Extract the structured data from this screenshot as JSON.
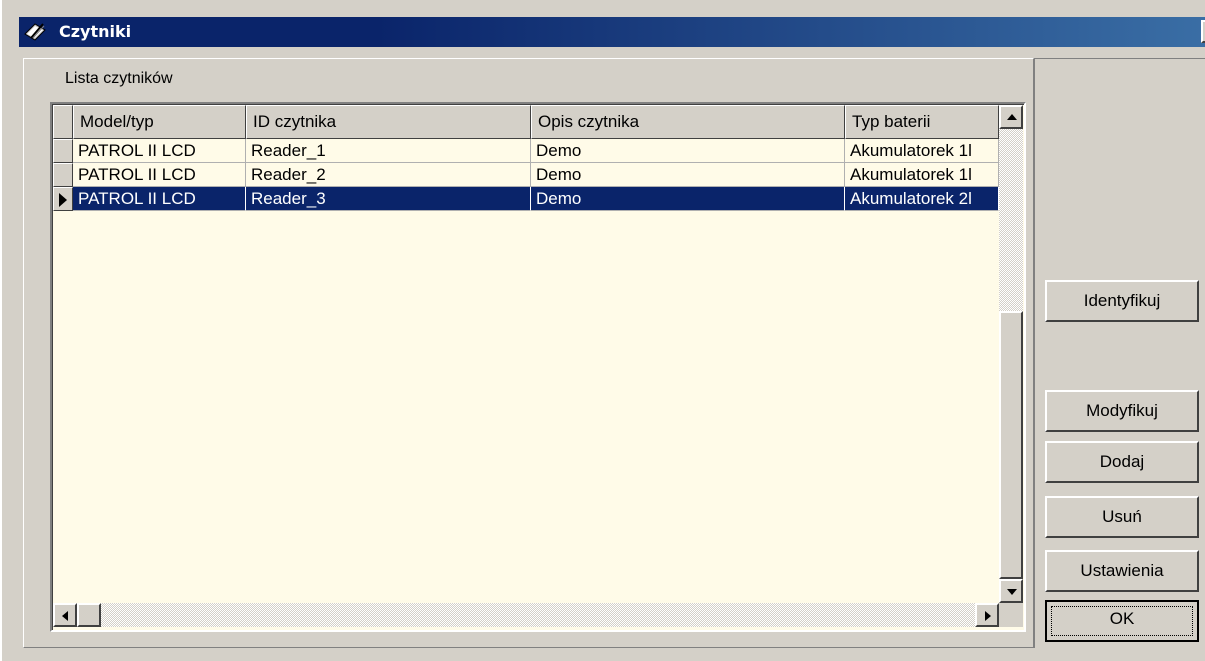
{
  "window": {
    "title": "Czytniki",
    "close_glyph": "✕"
  },
  "list": {
    "label": "Lista czytników",
    "columns": [
      "Model/typ",
      "ID czytnika",
      "Opis czytnika",
      "Typ  baterii"
    ],
    "rows": [
      {
        "model": "PATROL II LCD",
        "id": "Reader_1",
        "desc": "Demo",
        "battery": "Akumulatorek 1l"
      },
      {
        "model": "PATROL II LCD",
        "id": "Reader_2",
        "desc": "Demo",
        "battery": "Akumulatorek 1l"
      },
      {
        "model": "PATROL II LCD",
        "id": "Reader_3",
        "desc": "Demo",
        "battery": "Akumulatorek 2l"
      }
    ],
    "selected_row": 3
  },
  "buttons": {
    "identify": "Identyfikuj",
    "modify": "Modyfikuj",
    "add": "Dodaj",
    "delete": "Usuń",
    "settings": "Ustawienia",
    "ok": "OK"
  },
  "colors": {
    "titlebar": "#0a246a",
    "selection": "#0a246a",
    "grid_background": "#fffbe8",
    "face": "#d4d0c8"
  },
  "icons": {
    "app": "notepad-pencil-icon"
  }
}
